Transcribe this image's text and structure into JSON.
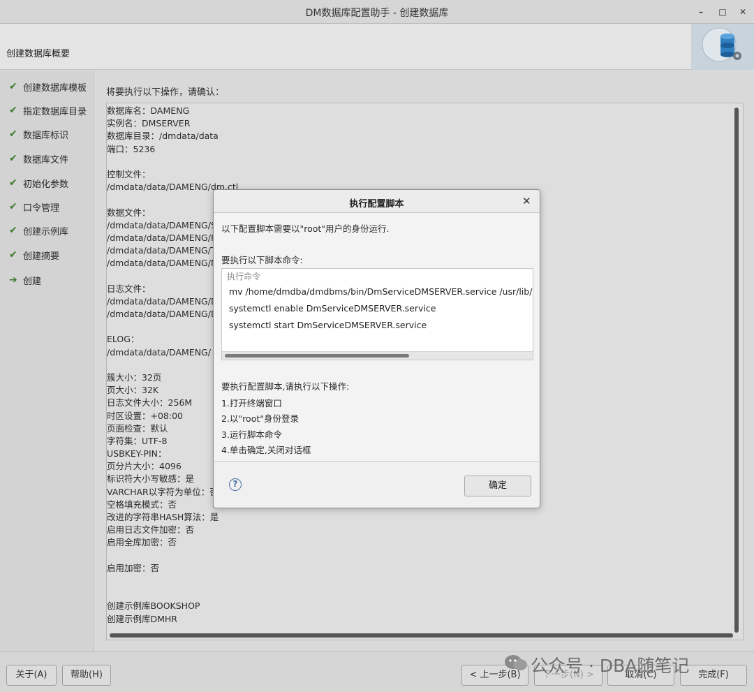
{
  "window": {
    "title": "DM数据库配置助手 - 创建数据库",
    "min_glyph": "–",
    "max_glyph": "□",
    "close_glyph": "✕"
  },
  "header": {
    "title": "创建数据库概要",
    "logo_icon": "database-logo-icon"
  },
  "steps": [
    {
      "label": "创建数据库模板",
      "status": "done"
    },
    {
      "label": "指定数据库目录",
      "status": "done"
    },
    {
      "label": "数据库标识",
      "status": "done"
    },
    {
      "label": "数据库文件",
      "status": "done"
    },
    {
      "label": "初始化参数",
      "status": "done"
    },
    {
      "label": "口令管理",
      "status": "done"
    },
    {
      "label": "创建示例库",
      "status": "done"
    },
    {
      "label": "创建摘要",
      "status": "done"
    },
    {
      "label": "创建",
      "status": "current"
    }
  ],
  "icons": {
    "done": "✔",
    "current": "➔",
    "help": "?",
    "close": "✕"
  },
  "summary": {
    "confirm_label": "将要执行以下操作，请确认：",
    "lines": [
      "数据库名：DAMENG",
      "实例名：DMSERVER",
      "数据库目录：/dmdata/data",
      "端口：5236",
      "",
      "控制文件：",
      "/dmdata/data/DAMENG/dm.ctl",
      "",
      "数据文件：",
      "/dmdata/data/DAMENG/SY",
      "/dmdata/data/DAMENG/RO",
      "/dmdata/data/DAMENG/TE",
      "/dmdata/data/DAMENG/MA",
      "",
      "日志文件：",
      "/dmdata/data/DAMENG/DA",
      "/dmdata/data/DAMENG/DA",
      "",
      "ELOG：",
      "/dmdata/data/DAMENG/",
      "",
      "簇大小：32页",
      "页大小：32K",
      "日志文件大小：256M",
      "时区设置：+08:00",
      "页面检查：默认",
      "字符集：UTF-8",
      "USBKEY-PIN：",
      "页分片大小：4096",
      "标识符大小写敏感：是",
      "VARCHAR以字符为单位：否",
      "空格填充模式：否",
      "改进的字符串HASH算法：是",
      "启用日志文件加密：否",
      "启用全库加密：否",
      "",
      "启用加密：否",
      "",
      "",
      "创建示例库BOOKSHOP",
      "创建示例库DMHR"
    ]
  },
  "footer": {
    "about": "关于(A)",
    "help": "帮助(H)",
    "prev": "< 上一步(B)",
    "next": "下一步(N) >",
    "cancel": "取消(C)",
    "finish": "完成(F)"
  },
  "watermark": {
    "text": "公众号 · DBA随笔记",
    "icon": "wechat-icon"
  },
  "dialog": {
    "title": "执行配置脚本",
    "intro": "以下配置脚本需要以\"root\"用户的身份运行.",
    "commands_label": "要执行以下脚本命令:",
    "column_header": "执行命令",
    "commands": [
      "mv /home/dmdba/dmdbms/bin/DmServiceDMSERVER.service /usr/lib/systemd/system/",
      "systemctl enable DmServiceDMSERVER.service",
      "systemctl start DmServiceDMSERVER.service"
    ],
    "instructions_title": "要执行配置脚本,请执行以下操作:",
    "instructions": [
      "1.打开终端窗口",
      "2.以\"root\"身份登录",
      "3.运行脚本命令",
      "4.单击确定,关闭对话框"
    ],
    "ok": "确定"
  }
}
